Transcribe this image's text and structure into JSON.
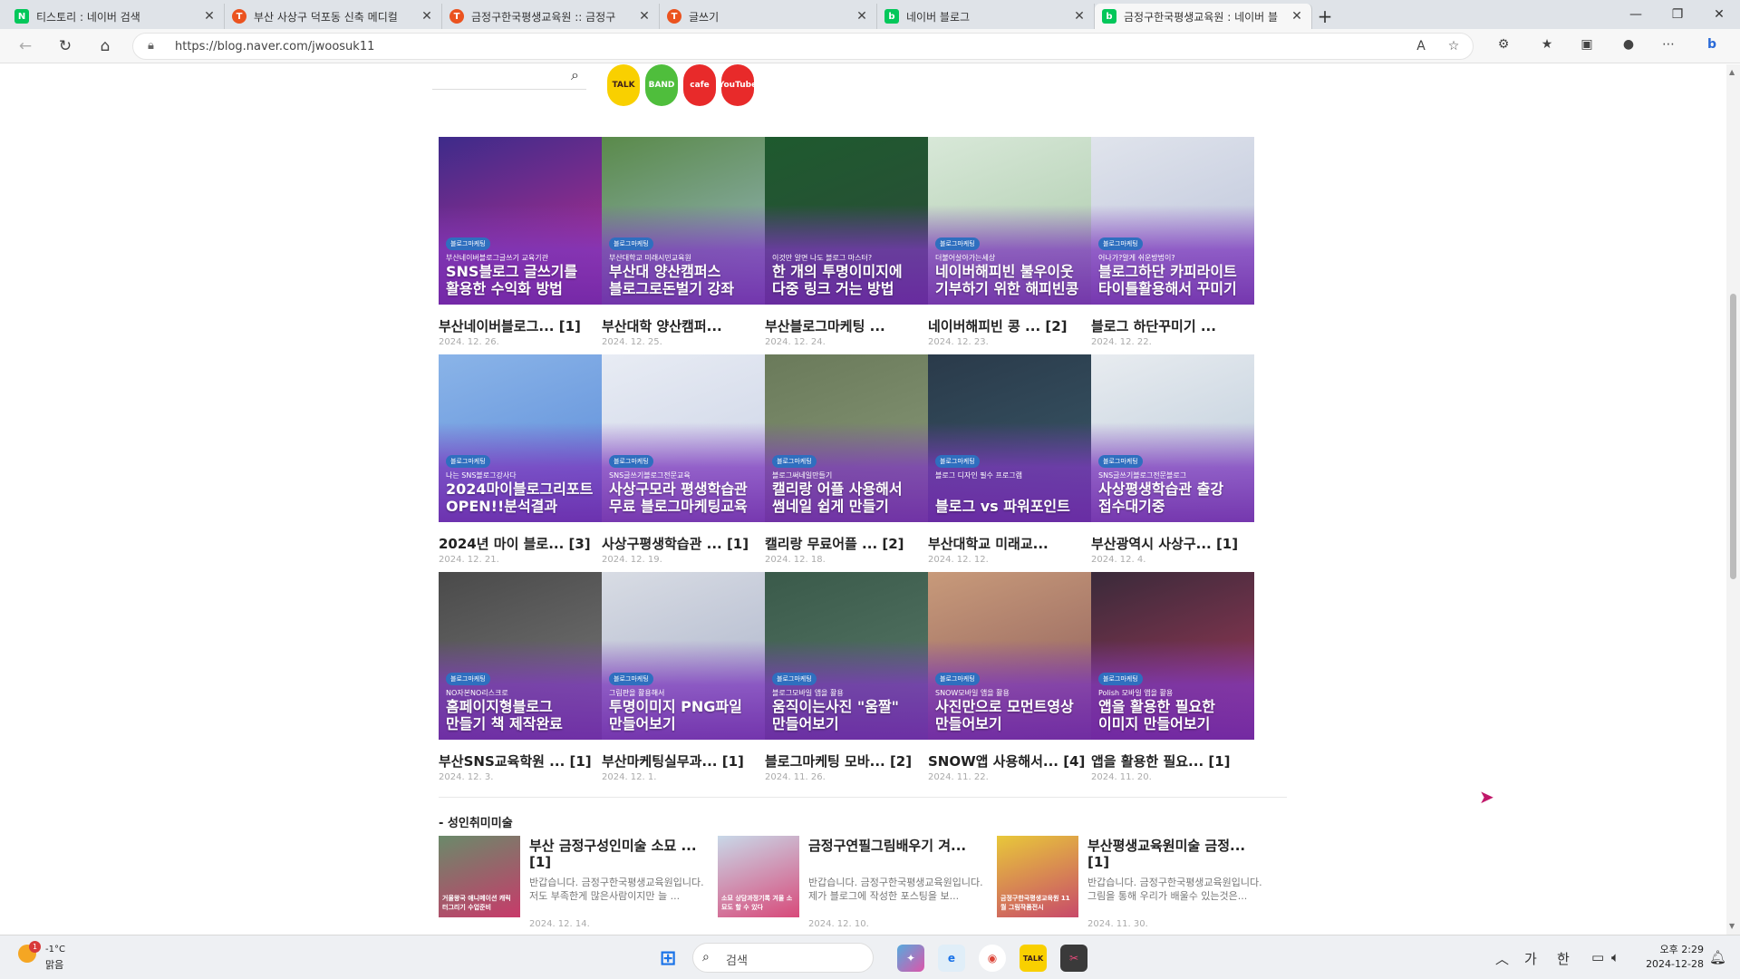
{
  "browser": {
    "tabs": [
      {
        "title": "티스토리 : 네이버 검색",
        "favicon": "N",
        "favicon_color": "#03c75a",
        "active": false
      },
      {
        "title": "부산 사상구 덕포동 신축 메디컬",
        "favicon": "T",
        "favicon_color": "#eb531f",
        "active": false
      },
      {
        "title": "금정구한국평생교육원 :: 금정구",
        "favicon": "T",
        "favicon_color": "#eb531f",
        "active": false
      },
      {
        "title": "글쓰기",
        "favicon": "T",
        "favicon_color": "#eb531f",
        "active": false
      },
      {
        "title": "네이버 블로그",
        "favicon": "b",
        "favicon_color": "#03c75a",
        "active": false
      },
      {
        "title": "금정구한국평생교육원 : 네이버 블",
        "favicon": "b",
        "favicon_color": "#03c75a",
        "active": true
      }
    ],
    "url": "https://blog.naver.com/jwoosuk11"
  },
  "blog": {
    "sns_icons": [
      {
        "label": "TALK",
        "bg": "#f9d000",
        "fg": "#3a1d1d"
      },
      {
        "label": "BAND",
        "bg": "#4fbe3c",
        "fg": "#ffffff"
      },
      {
        "label": "cafe",
        "bg": "#e82a2a",
        "fg": "#ffffff"
      },
      {
        "label": "YouTube",
        "bg": "#e82a2a",
        "fg": "#ffffff"
      }
    ],
    "posts": [
      {
        "title": "부산네이버블로그... [1]",
        "date": "2024. 12. 26.",
        "tag": "블로그마케팅",
        "sub": "부산네이버블로그글쓰기 교육기관",
        "headline": "SNS블로그 글쓰기를\n활용한 수익화 방법",
        "bg1": "#3d2b8a",
        "bg2": "#c22e8f"
      },
      {
        "title": "부산대학 양산캠퍼...",
        "date": "2024. 12. 25.",
        "tag": "블로그마케팅",
        "sub": "부산대학교 미래시민교육원",
        "headline": "부산대 양산캠퍼스\n블로그로돈벌기 강좌",
        "bg1": "#5a8a4a",
        "bg2": "#9bb8c8"
      },
      {
        "title": "부산블로그마케팅 ...",
        "date": "2024. 12. 24.",
        "tag": "",
        "sub": "이것만 알면 나도 블로그 마스터?",
        "headline": "한 개의 투명이미지에\n다중 링크 거는 방법",
        "bg1": "#1e5a2e",
        "bg2": "#2d4a3a"
      },
      {
        "title": "네이버해피빈 콩 ... [2]",
        "date": "2024. 12. 23.",
        "tag": "블로그마케팅",
        "sub": "더불어살아가는세상",
        "headline": "네이버해피빈 불우이웃\n기부하기 위한 해피빈콩",
        "bg1": "#d8e8d8",
        "bg2": "#a8c8a8"
      },
      {
        "title": "블로그 하단꾸미기 ...",
        "date": "2024. 12. 22.",
        "tag": "블로그마케팅",
        "sub": "어나가?알게 쉬운방법이?",
        "headline": "블로그하단 카피라이트\n타이틀활용해서 꾸미기",
        "bg1": "#e0e4ec",
        "bg2": "#b8c0d8"
      },
      {
        "title": "2024년 마이 블로... [3]",
        "date": "2024. 12. 21.",
        "tag": "블로그마케팅",
        "sub": "나는 SNS블로그강사다",
        "headline": "2024마이블로그리포트\nOPEN!!분석결과",
        "bg1": "#8ab4e8",
        "bg2": "#5a8ad8"
      },
      {
        "title": "사상구평생학습관 ... [1]",
        "date": "2024. 12. 19.",
        "tag": "블로그마케팅",
        "sub": "SNS글쓰기블로그전문교육",
        "headline": "사상구모라 평생학습관\n무료 블로그마케팅교육",
        "bg1": "#e8ecf4",
        "bg2": "#c8d0e4"
      },
      {
        "title": "캘리랑 무료어플 ... [2]",
        "date": "2024. 12. 18.",
        "tag": "블로그마케팅",
        "sub": "블로그써네일만들기",
        "headline": "캘리랑 어플 사용해서\n썸네일 쉽게 만들기",
        "bg1": "#6a7a5a",
        "bg2": "#8a9a7a"
      },
      {
        "title": "부산대학교 미래교...",
        "date": "2024. 12. 12.",
        "tag": "블로그마케팅",
        "sub": "블로그 디자인 필수 프로그램",
        "headline": "블로그 vs 파워포인트",
        "bg1": "#2a3a4a",
        "bg2": "#3a5a6a"
      },
      {
        "title": "부산광역시 사상구... [1]",
        "date": "2024. 12. 4.",
        "tag": "블로그마케팅",
        "sub": "SNS글쓰기블로그전문블로그",
        "headline": "사상평생학습관 출강\n접수대기중",
        "bg1": "#e8ecf0",
        "bg2": "#b8c8d8"
      },
      {
        "title": "부산SNS교육학원 ... [1]",
        "date": "2024. 12. 3.",
        "tag": "블로그마케팅",
        "sub": "NO자본NO리스크로",
        "headline": "홈페이지형블로그\n만들기 책 제작완료",
        "bg1": "#4a4a4a",
        "bg2": "#7a7a7a"
      },
      {
        "title": "부산마케팅실무과... [1]",
        "date": "2024. 12. 1.",
        "tag": "블로그마케팅",
        "sub": "그림판을 활용해서",
        "headline": "투명이미지 PNG파일\n만들어보기",
        "bg1": "#d8dce4",
        "bg2": "#a8b0c8"
      },
      {
        "title": "블로그마케팅 모바... [2]",
        "date": "2024. 11. 26.",
        "tag": "블로그마케팅",
        "sub": "블로그모바일 앱을 활용",
        "headline": "움직이는사진 \"움짤\"\n만들어보기",
        "bg1": "#3a5a4a",
        "bg2": "#5a7a6a"
      },
      {
        "title": "SNOW앱 사용해서... [4]",
        "date": "2024. 11. 22.",
        "tag": "블로그마케팅",
        "sub": "SNOW모바일 앱을 활용",
        "headline": "사진만으로 모먼트영상\n만들어보기",
        "bg1": "#c89a7a",
        "bg2": "#8a5a5a"
      },
      {
        "title": "앱을 활용한 필요... [1]",
        "date": "2024. 11. 20.",
        "tag": "블로그마케팅",
        "sub": "Polish 모바일 앱을 활용",
        "headline": "앱을 활용한 필요한\n이미지 만들어보기",
        "bg1": "#3a2a3a",
        "bg2": "#a83a5a"
      }
    ],
    "category": {
      "title": "- 성인취미미술",
      "posts": [
        {
          "title": "부산 금정구성인미술 소묘 ... [1]",
          "desc": "반갑습니다. 금정구한국평생교육원입니다. 저도 부족한게 많은사람이지만 늘 ...",
          "date": "2024. 12. 14.",
          "thumb_caption": "거울왕국 애니메이션 캐릭터그리기 수업준비",
          "bg1": "#6a8a6a",
          "bg2": "#c83a6a"
        },
        {
          "title": "금정구연필그림배우기 겨...",
          "desc": "반갑습니다. 금정구한국평생교육원입니다. 제가 블로그에 작성한 포스팅을 보...",
          "date": "2024. 12. 10.",
          "thumb_caption": "소묘 상담과정기록 겨울 소묘도 할 수 있다",
          "bg1": "#c8d8e8",
          "bg2": "#d84a7a"
        },
        {
          "title": "부산평생교육원미술 금정... [1]",
          "desc": "반갑습니다. 금정구한국평생교육원입니다. 그림을 통해 우리가 배울수 있는것은...",
          "date": "2024. 11. 30.",
          "thumb_caption": "금정구한국평생교육원 11월 그림작품전시",
          "bg1": "#e8c83a",
          "bg2": "#c84a6a"
        }
      ]
    }
  },
  "taskbar": {
    "weather_temp": "-1°C",
    "weather_desc": "맑음",
    "weather_badge": "1",
    "search_label": "검색",
    "clock_time": "오후 2:29",
    "clock_date": "2024-12-28",
    "tray_lang1": "가",
    "tray_lang2": "한"
  }
}
